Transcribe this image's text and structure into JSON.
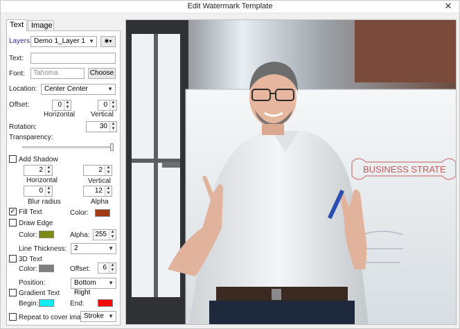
{
  "window": {
    "title": "Edit Watermark Template",
    "close_glyph": "✕"
  },
  "tabs": [
    {
      "label": "Text"
    },
    {
      "label": "Image"
    }
  ],
  "panel": {
    "layers_label": "Layers:",
    "layers_value": "Demo 1_Layer 1",
    "gear_glyph": "✱▾",
    "text_label": "Text:",
    "text_value": "",
    "font_label": "Font:",
    "font_value": "Tahoma",
    "choose_label": "Choose",
    "location_label": "Location:",
    "location_value": "Center Center",
    "offset_label": "Offset:",
    "offset_h": "0",
    "offset_v": "0",
    "horizontal_label": "Horizontal",
    "vertical_label": "Vertical",
    "rotation_label": "Rotation:",
    "rotation_value": "30",
    "transparency_label": "Transparency:",
    "transparency_level": 1.0,
    "add_shadow_label": "Add Shadow",
    "add_shadow_checked": false,
    "shadow_h": "2",
    "shadow_v": "2",
    "shadow_h_label": "Horizontal",
    "shadow_v_label": "Vertical",
    "blur_value": "0",
    "alpha_value": "12",
    "blur_label": "Blur radius",
    "alpha_label": "Alpha",
    "fill_text_label": "Fill Text",
    "fill_text_checked": true,
    "fill_color_label": "Color:",
    "fill_color": "#a23a12",
    "draw_edge_label": "Draw Edge",
    "draw_edge_checked": false,
    "edge_color_label": "Color:",
    "edge_color": "#7d8a12",
    "edge_alpha_label": "Alpha:",
    "edge_alpha_value": "255",
    "line_thickness_label": "Line Thickness:",
    "line_thickness_value": "2",
    "text3d_label": "3D Text",
    "text3d_checked": false,
    "text3d_color_label": "Color:",
    "text3d_color": "#7f7f7f",
    "text3d_offset_label": "Offset:",
    "text3d_offset_value": "6",
    "position_label": "Position:",
    "position_value": "Bottom Right",
    "gradient_label": "Gradient Text",
    "gradient_checked": false,
    "begin_label": "Begin:",
    "begin_color": "#11ecf3",
    "end_label": "End:",
    "end_color": "#f30b0b",
    "repeat_label": "Repeat to cover image",
    "repeat_checked": false,
    "stroke_value": "Stroke"
  },
  "preview": {
    "whiteboard_text": "BUSINESS STRATE"
  }
}
